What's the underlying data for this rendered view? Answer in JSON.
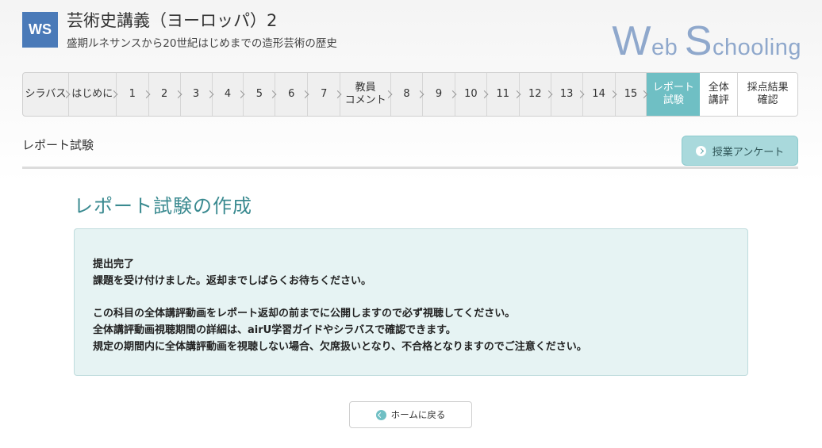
{
  "header": {
    "logo_text": "WS",
    "course_title": "芸術史講義（ヨーロッパ）2",
    "course_subtitle": "盛期ルネサンスから20世紀はじめまでの造形芸術の歴史",
    "brand_w": "W",
    "brand_eb": "eb ",
    "brand_s": "S",
    "brand_chooling": "chooling"
  },
  "tabs": [
    {
      "label": "シラバス",
      "state": "gray"
    },
    {
      "label": "はじめに",
      "state": "gray"
    },
    {
      "label": "1",
      "state": "gray"
    },
    {
      "label": "2",
      "state": "gray"
    },
    {
      "label": "3",
      "state": "gray"
    },
    {
      "label": "4",
      "state": "gray"
    },
    {
      "label": "5",
      "state": "gray"
    },
    {
      "label": "6",
      "state": "gray"
    },
    {
      "label": "7",
      "state": "gray"
    },
    {
      "label": "教員\nコメント",
      "state": "gray"
    },
    {
      "label": "8",
      "state": "gray"
    },
    {
      "label": "9",
      "state": "gray"
    },
    {
      "label": "10",
      "state": "gray"
    },
    {
      "label": "11",
      "state": "gray"
    },
    {
      "label": "12",
      "state": "gray"
    },
    {
      "label": "13",
      "state": "gray"
    },
    {
      "label": "14",
      "state": "gray"
    },
    {
      "label": "15",
      "state": "gray"
    },
    {
      "label": "レポート\n試験",
      "state": "active"
    },
    {
      "label": "全体\n講評",
      "state": "white"
    },
    {
      "label": "採点結果\n確認",
      "state": "white"
    }
  ],
  "page": {
    "label": "レポート試験",
    "survey_button": "授業アンケート",
    "heading": "レポート試験の作成"
  },
  "notice": {
    "line1": "提出完了",
    "line2": "課題を受け付けました。返却までしばらくお待ちください。",
    "line3": "この科目の全体講評動画をレポート返却の前までに公開しますので必ず視聴してください。",
    "line4": "全体講評動画視聴期間の詳細は、airU学習ガイドやシラバスで確認できます。",
    "line5": "規定の期間内に全体講評動画を視聴しない場合、欠席扱いとなり、不合格となりますのでご注意ください。"
  },
  "home_button": "ホームに戻る",
  "colors": {
    "accent": "#6fbfc4",
    "logo": "#4a7ab8",
    "notice_bg": "#e6f3f3",
    "heading": "#3a8a90"
  }
}
